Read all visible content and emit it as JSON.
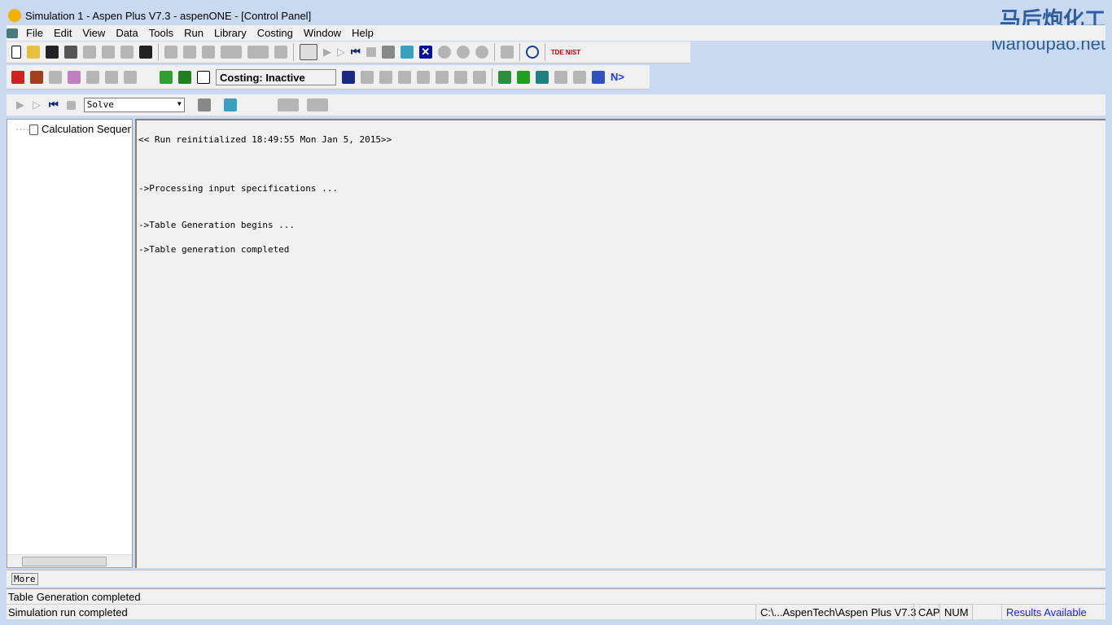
{
  "window": {
    "title": "Simulation 1 - Aspen Plus V7.3 - aspenONE - [Control Panel]"
  },
  "menu": [
    "File",
    "Edit",
    "View",
    "Data",
    "Tools",
    "Run",
    "Library",
    "Costing",
    "Window",
    "Help"
  ],
  "toolbar": {
    "costing_label": "Costing: Inactive",
    "run_mode": "Solve",
    "nist_label": "TDE NIST",
    "n_label": "N>"
  },
  "tree": {
    "item": "Calculation Sequer"
  },
  "log": [
    "<< Run reinitialized 18:49:55 Mon Jan 5, 2015>>",
    "->Processing input specifications ...",
    "->Table Generation begins ...",
    "->Table generation completed"
  ],
  "more_button": "More",
  "message": "Table Generation completed",
  "statusbar": {
    "left": "Simulation run completed",
    "path": "C:\\...AspenTech\\Aspen Plus V7.3",
    "cap": "CAP",
    "num": "NUM",
    "results": "Results Available",
    "results_color": "#1a1aff"
  },
  "watermark": {
    "cn": "马后炮化工",
    "en": "Mahoupao.net"
  }
}
